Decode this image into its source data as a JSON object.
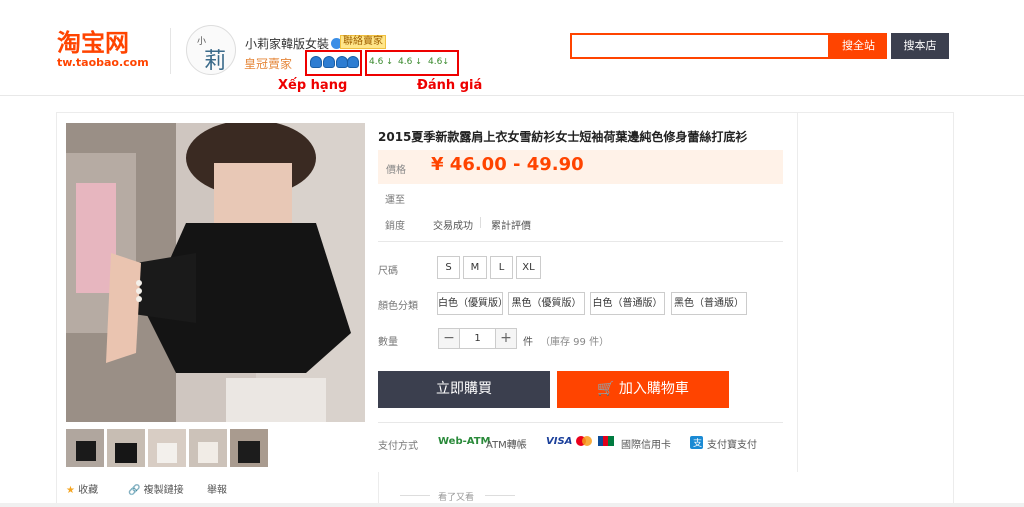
{
  "header": {
    "logo_cn": "淘宝网",
    "logo_url": "tw.taobao.com",
    "shop_avatar_small": "小",
    "shop_avatar_char": "莉",
    "shop_name": "小莉家韓版女裝",
    "shop_badge": "聯絡賣家",
    "seller_level": "皇冠賣家",
    "ratings": [
      "4.6",
      "4.6",
      "4.6"
    ],
    "rating_arrow": "↓",
    "caption_rank": "Xếp hạng",
    "caption_rating": "Đánh giá",
    "search_all_label": "搜全站",
    "search_store_label": "搜本店",
    "accent_color": "#ff4400",
    "dark_color": "#3b3f4e",
    "annotation_color": "#ee0000"
  },
  "product": {
    "title": "2015夏季新款露肩上衣女雪紡衫女士短袖荷葉邊純色修身蕾絲打底衫",
    "price_label": "價格",
    "price": "¥ 46.00 - 49.90",
    "shipping_label": "運至",
    "sales_label": "銷度",
    "deals_label": "交易成功",
    "reviews_label": "累計評價",
    "size_label": "尺碼",
    "sizes": [
      "S",
      "M",
      "L",
      "XL"
    ],
    "color_label": "顏色分類",
    "colors": [
      "白色（優質版）",
      "黑色（優質版）",
      "白色（普通版）",
      "黑色（普通版）"
    ],
    "qty_label": "數量",
    "qty_minus": "−",
    "qty_value": "1",
    "qty_plus": "+",
    "qty_unit": "件",
    "stock": "（庫存 99 件）",
    "buy_now": "立即購買",
    "add_to_cart": "🛒 加入購物車",
    "payment_label": "支付方式",
    "payments": [
      "Web-ATM",
      "ATM轉帳",
      "VISA",
      "國際信用卡",
      "支付寶支付"
    ],
    "seen_more": "看了又看"
  },
  "actions": {
    "favorite": "收藏",
    "copy_link": "複製鏈接",
    "report": "舉報"
  }
}
